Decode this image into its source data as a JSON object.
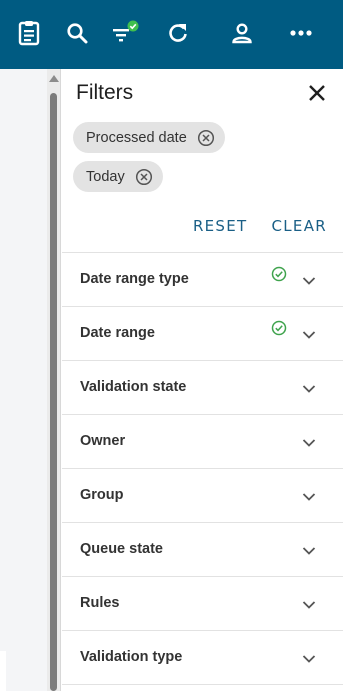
{
  "colors": {
    "topbar": "#005b82",
    "accent": "#1a5f86",
    "success": "#3fa34d"
  },
  "toolbar": {
    "icons": [
      "clipboard-icon",
      "search-icon",
      "filter-icon",
      "refresh-icon",
      "user-icon",
      "more-icon"
    ]
  },
  "panel": {
    "title": "Filters",
    "chips": [
      "Processed date",
      "Today"
    ],
    "reset_label": "RESET",
    "clear_label": "CLEAR",
    "filters": [
      {
        "label": "Date range type",
        "active": true
      },
      {
        "label": "Date range",
        "active": true
      },
      {
        "label": "Validation state",
        "active": false
      },
      {
        "label": "Owner",
        "active": false
      },
      {
        "label": "Group",
        "active": false
      },
      {
        "label": "Queue state",
        "active": false
      },
      {
        "label": "Rules",
        "active": false
      },
      {
        "label": "Validation type",
        "active": false
      }
    ]
  }
}
